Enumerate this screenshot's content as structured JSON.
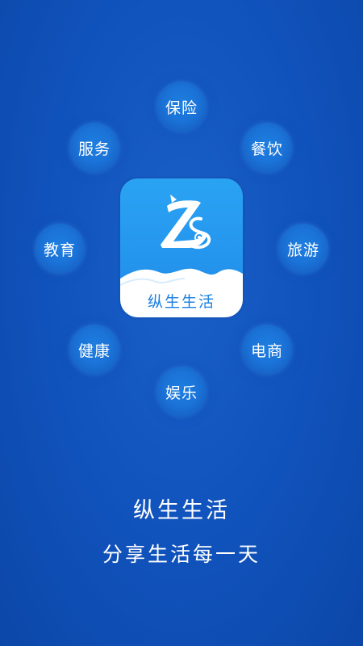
{
  "app_icon": {
    "name": "纵生生活"
  },
  "categories": [
    {
      "label": "保险",
      "icon": "bubble"
    },
    {
      "label": "餐饮",
      "icon": "bubble"
    },
    {
      "label": "旅游",
      "icon": "bubble"
    },
    {
      "label": "电商",
      "icon": "bubble"
    },
    {
      "label": "娱乐",
      "icon": "bubble"
    },
    {
      "label": "健康",
      "icon": "bubble"
    },
    {
      "label": "教育",
      "icon": "bubble"
    },
    {
      "label": "服务",
      "icon": "bubble"
    }
  ],
  "title": "纵生生活",
  "slogan": "分享生活每一天",
  "colors": {
    "background": "#1052bb",
    "bubble": "#1b73d8",
    "icon_blue": "#2596ee",
    "text": "#ffffff"
  }
}
